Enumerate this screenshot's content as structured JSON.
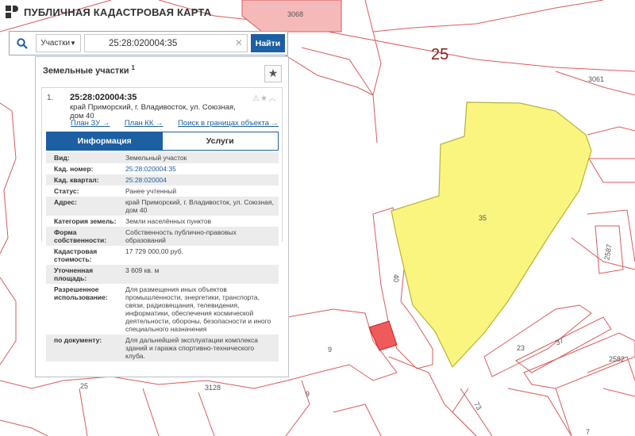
{
  "header": {
    "title": "ПУБЛИЧНАЯ КАДАСТРОВАЯ КАРТА",
    "logo_icon": "pkk-logo-icon"
  },
  "search": {
    "type_label": "Участки",
    "value": "25:28:020004:35",
    "button_label": "Найти"
  },
  "panel": {
    "title": "Земельные участки",
    "count": "1",
    "card": {
      "index": "1.",
      "number": "25:28:020004:35",
      "address": "край Приморский, г. Владивосток, ул. Союзная, дом 40",
      "links": [
        "План ЗУ →",
        "План КК →",
        "Поиск в границах объекта →"
      ]
    },
    "tabs": [
      "Информация",
      "Услуги"
    ],
    "active_tab": "Информация",
    "attributes": [
      {
        "key": "Вид:",
        "value": "Земельный участок"
      },
      {
        "key": "Кад. номер:",
        "value": "25:28:020004:35",
        "link": true
      },
      {
        "key": "Кад. квартал:",
        "value": "25:28:020004",
        "link": true
      },
      {
        "key": "Статус:",
        "value": "Ранее учтенный"
      },
      {
        "key": "Адрес:",
        "value": "край Приморский, г. Владивосток, ул. Союзная, дом 40"
      },
      {
        "key": "Категория земель:",
        "value": "Земли населённых пунктов"
      },
      {
        "key": "Форма собственности:",
        "value": "Собственность публично-правовых образований"
      },
      {
        "key": "Кадастровая стоимость:",
        "value": "17 729 000,00 руб."
      },
      {
        "key": "Уточненная площадь:",
        "value": "3 609 кв. м"
      },
      {
        "key": "Разрешенное использование:",
        "value": "Для размещения иных объектов промышленности, энергетики, транспорта, связи, радиовещания, телевидения, информатики, обеспечения космической деятельности, обороны, безопасности и иного специального назначения"
      },
      {
        "key": "по документу:",
        "value": "Для дальнейшей эксплуатации комплекса зданий и гаража спортивно-технического клуба."
      }
    ]
  },
  "map": {
    "labels": [
      "25",
      "3068",
      "3061",
      "35",
      "40",
      "9",
      "9",
      "23",
      "37",
      "2582",
      "2587",
      "25",
      "3128",
      "73",
      "7"
    ],
    "colors": {
      "parcel_fill": "#f9f57f",
      "parcel_stroke": "#b8b23a",
      "boundary": "#d95b5b",
      "block_number": "#8b1a1a",
      "highlight": "#f6b9b9"
    }
  }
}
